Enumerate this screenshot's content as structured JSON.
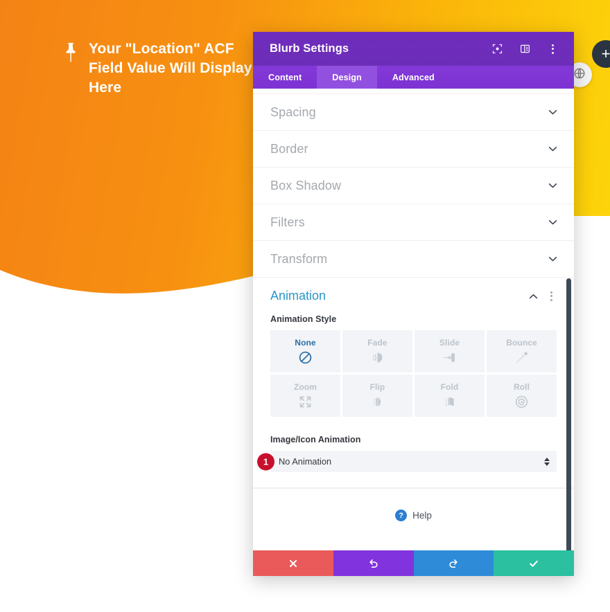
{
  "page": {
    "hero": {
      "icon": "map-pin-icon",
      "title": "Your \"Location\" ACF Field Value Will Display Here",
      "gradient_from": "#f48315",
      "gradient_to": "#fcd70a"
    },
    "floating": {
      "globe_icon": "globe-icon",
      "add_label": "+"
    }
  },
  "modal": {
    "title": "Blurb Settings",
    "header_color": "#6c2eb9",
    "header_icons": [
      {
        "name": "focus-frame-icon"
      },
      {
        "name": "layout-panel-icon"
      },
      {
        "name": "kebab-menu-icon"
      }
    ],
    "tabs": [
      {
        "label": "Content",
        "active": false
      },
      {
        "label": "Design",
        "active": true
      },
      {
        "label": "Advanced",
        "active": false
      }
    ],
    "sections": [
      {
        "label": "Spacing",
        "state": "collapsed"
      },
      {
        "label": "Border",
        "state": "collapsed"
      },
      {
        "label": "Box Shadow",
        "state": "collapsed"
      },
      {
        "label": "Filters",
        "state": "collapsed"
      },
      {
        "label": "Transform",
        "state": "collapsed"
      }
    ],
    "animation_section": {
      "label": "Animation",
      "state": "expanded",
      "style_field_label": "Animation Style",
      "styles": [
        {
          "label": "None",
          "icon": "no-entry-icon",
          "selected": true
        },
        {
          "label": "Fade",
          "icon": "fade-icon",
          "selected": false
        },
        {
          "label": "Slide",
          "icon": "slide-icon",
          "selected": false
        },
        {
          "label": "Bounce",
          "icon": "bounce-icon",
          "selected": false
        },
        {
          "label": "Zoom",
          "icon": "zoom-arrows-icon",
          "selected": false
        },
        {
          "label": "Flip",
          "icon": "flip-icon",
          "selected": false
        },
        {
          "label": "Fold",
          "icon": "fold-icon",
          "selected": false
        },
        {
          "label": "Roll",
          "icon": "roll-spiral-icon",
          "selected": false
        }
      ],
      "image_icon_animation": {
        "label": "Image/Icon Animation",
        "value": "No Animation",
        "step_badge": "1",
        "badge_color": "#c8102e"
      }
    },
    "help": {
      "icon": "question-mark-icon",
      "label": "Help"
    },
    "footer_buttons": [
      {
        "name": "cancel",
        "icon": "close-x-icon",
        "color": "#ea5a5a"
      },
      {
        "name": "undo",
        "icon": "undo-arrow-icon",
        "color": "#8133dd"
      },
      {
        "name": "redo",
        "icon": "redo-arrow-icon",
        "color": "#2d8bd8"
      },
      {
        "name": "save",
        "icon": "checkmark-icon",
        "color": "#2ac0a0"
      }
    ]
  }
}
